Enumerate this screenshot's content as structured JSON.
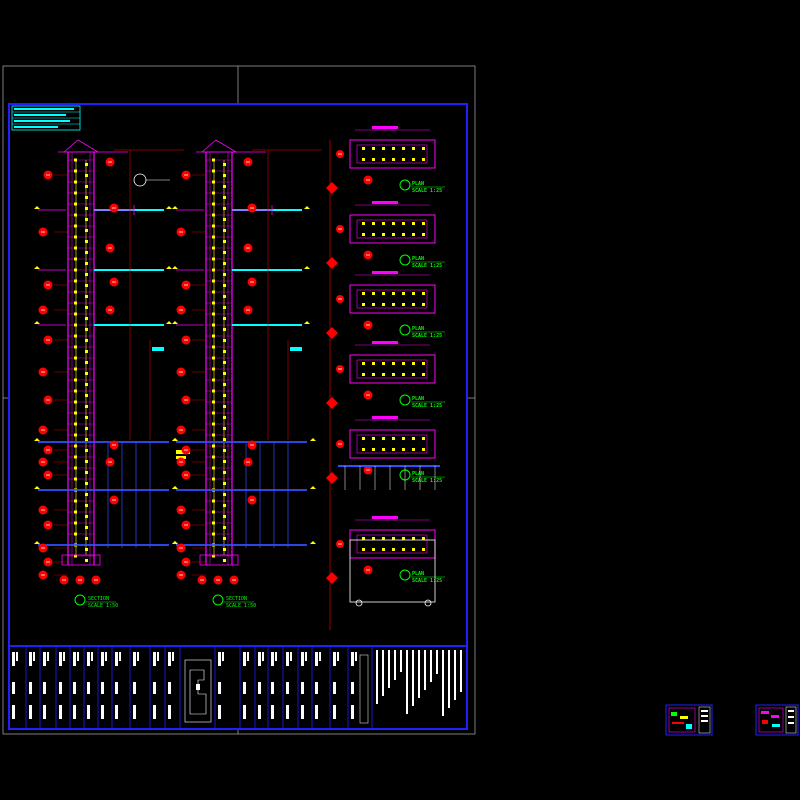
{
  "drawing": {
    "sections": [
      {
        "title": "SECTION",
        "scale": "SCALE 1:50"
      },
      {
        "title": "SECTION",
        "scale": "SCALE 1:50"
      }
    ],
    "plans": [
      {
        "title": "PLAN",
        "scale": "SCALE 1:25"
      },
      {
        "title": "PLAN",
        "scale": "SCALE 1:25"
      },
      {
        "title": "PLAN",
        "scale": "SCALE 1:25"
      },
      {
        "title": "PLAN",
        "scale": "SCALE 1:25"
      },
      {
        "title": "PLAN",
        "scale": "SCALE 1:25"
      },
      {
        "title": "PLAN",
        "scale": "SCALE 1:25"
      }
    ]
  },
  "colors": {
    "background": "#000000",
    "frame": "#2020ff",
    "section": "#ff00ff",
    "dimension": "#00ffff",
    "callout": "#ff0000",
    "text": "#00ff00",
    "titleblock": "#ffffff",
    "yellow": "#ffff00"
  }
}
